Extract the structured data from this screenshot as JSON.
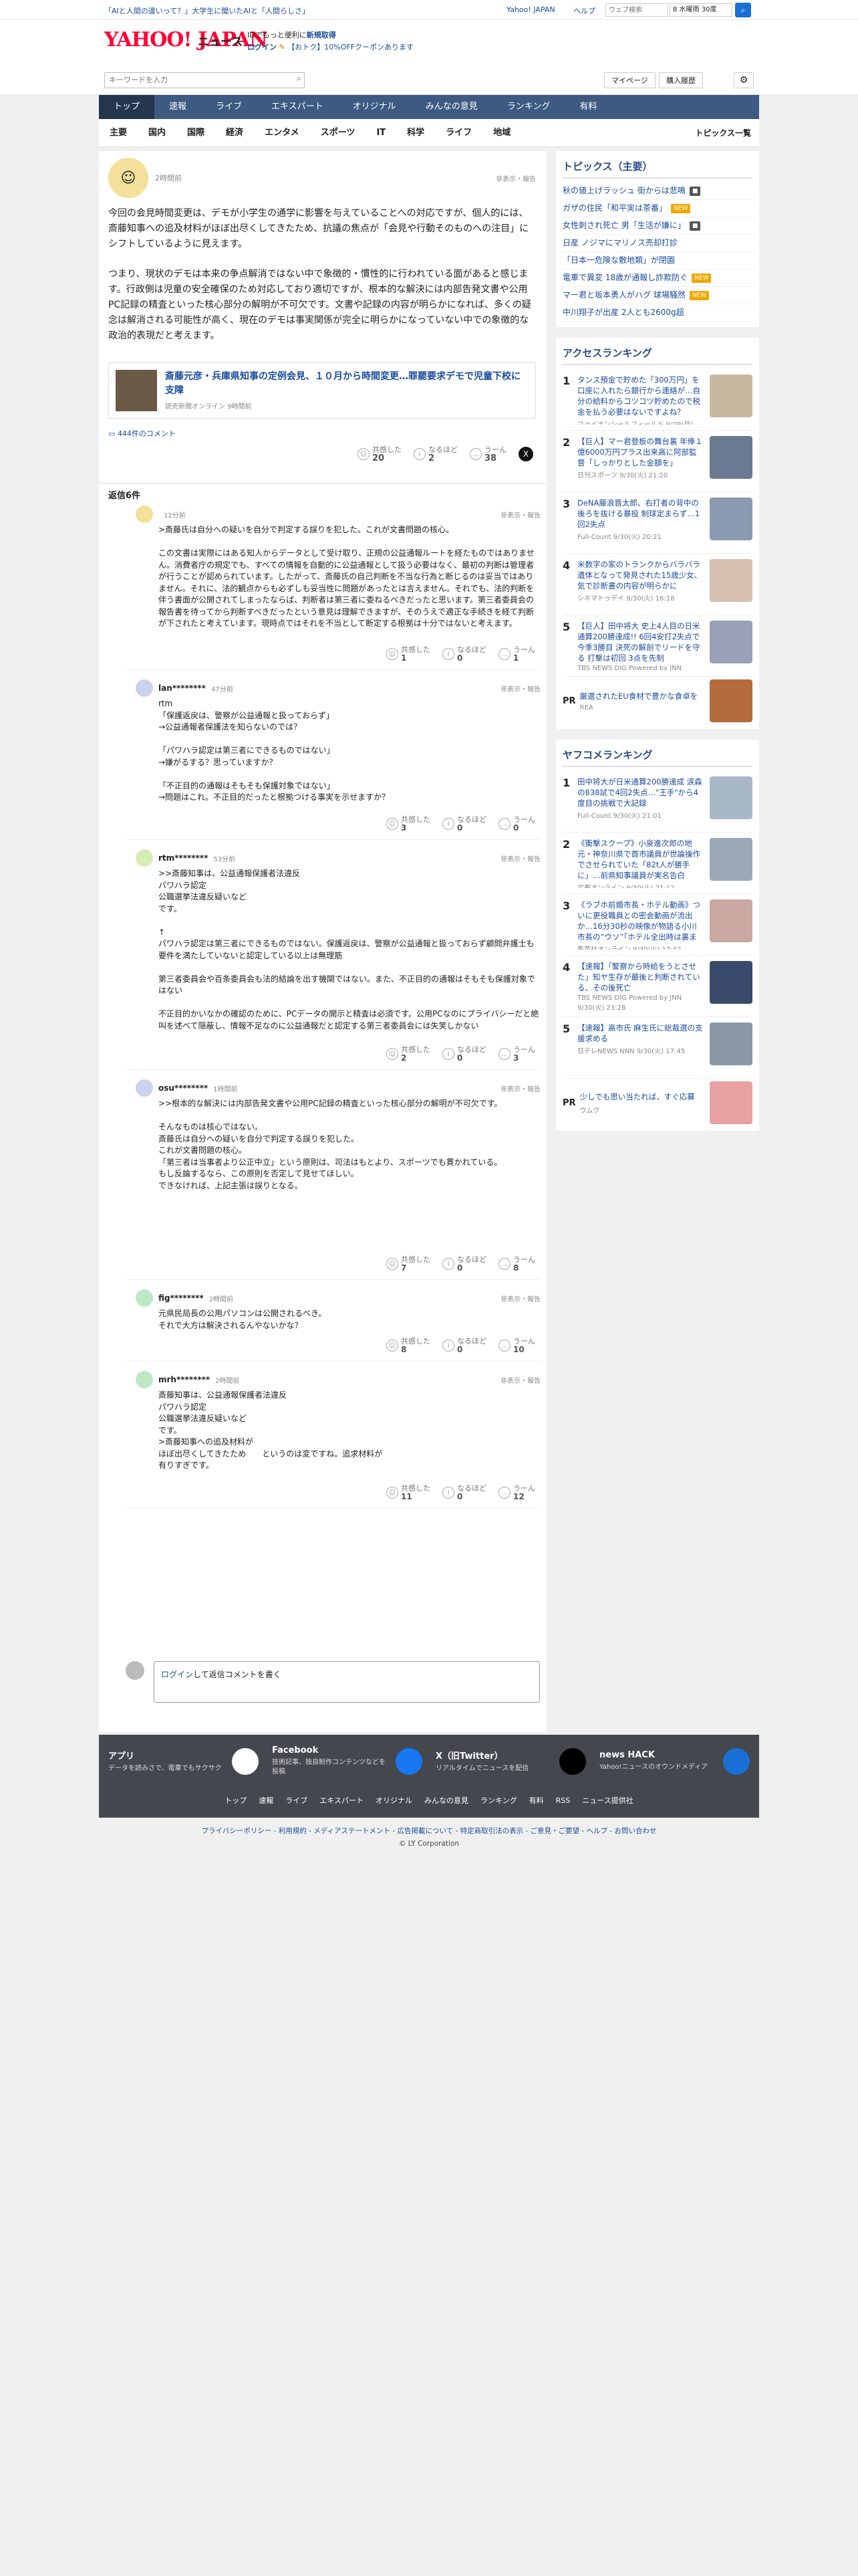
{
  "topbar": {
    "promo": "「AIと人間の違いって？」大学生に聞いたAIと「人間らしさ」",
    "links": [
      "Yahoo! JAPAN",
      "ヘルプ"
    ],
    "search_placeholder": "ウェブ検索",
    "weather": "8 水曜雨 30度"
  },
  "header": {
    "logo": "YAHOO! JAPAN",
    "logo_sub": "ニュース",
    "promo1": "IDでもっと便利に",
    "promo1b": "新規取得",
    "login": "ログイン",
    "promo2": "【おトク】10%OFFクーポンあります"
  },
  "search": {
    "placeholder": "キーワードを入力",
    "mypage": "マイページ",
    "history": "購入履歴"
  },
  "nav1": [
    "トップ",
    "速報",
    "ライブ",
    "エキスパート",
    "オリジナル",
    "みんなの意見",
    "ランキング",
    "有料"
  ],
  "nav2": [
    "主要",
    "国内",
    "国際",
    "経済",
    "エンタメ",
    "スポーツ",
    "IT",
    "科学",
    "ライフ",
    "地域"
  ],
  "nav2_right": "トピックス一覧",
  "post": {
    "time": "2時間前",
    "flag": "非表示・報告",
    "p1": "今回の会見時間変更は、デモが小学生の通学に影響を与えていることへの対応ですが、個人的には、斎藤知事への追及材料がほぼ出尽くしてきたため、抗議の焦点が「会見や行動そのものへの注目」にシフトしているように見えます。",
    "p2": "つまり、現状のデモは本来の争点解消ではない中で象徴的・慣性的に行われている面があると感じます。行政側は児童の安全確保のため対応しており適切ですが、根本的な解決には内部告発文書や公用PC記録の精査といった核心部分の解明が不可欠です。文書や記録の内容が明らかになれば、多くの疑念は解消される可能性が高く、現在のデモは事実関係が完全に明らかになっていない中での象徴的な政治的表現だと考えます。",
    "article": {
      "title": "斎藤元彦・兵庫県知事の定例会見、１０月から時間変更…罪罷要求デモで児童下校に支障",
      "source": "読売新聞オンライン",
      "age": "9時間前"
    },
    "comments_link": "444件のコメント",
    "reactions": [
      {
        "label": "共感した",
        "count": "20"
      },
      {
        "label": "なるほど",
        "count": "2"
      },
      {
        "label": "うーん",
        "count": "38"
      }
    ]
  },
  "replies_title": "返信6件",
  "replies": [
    {
      "user": "",
      "time": "12分前",
      "flag": "非表示・報告",
      "text": ">斎藤氏は自分への疑いを自分で判定する誤りを犯した。これが文書問題の核心。\n\nこの文書は実際にはある知人からデータとして受け取り、正規の公益通報ルートを経たものではありません。消費者庁の規定でも、すべての情報を自動的に公益通報として扱う必要はなく、最初の判断は管理者が行うことが認められています。したがって、斎藤氏の自己判断を不当な行為と断じるのは妥当ではありません。それに、法的観点からも必ずしも妥当性に問題があったとは言えません。それでも、法的判断を伴う書面が公開されてしまったならば、判断者は第三者に委ねるべきだったと思います。第三者委員会の報告書を待ってから判断すべきだったという意見は理解できますが、そのうえで適正な手続きを経て判断が下されたと考えています。現時点ではそれを不当として断定する根拠は十分ではないと考えます。",
      "reactions": [
        "1",
        "0",
        "1"
      ]
    },
    {
      "user": "lan********",
      "time": "47分前",
      "flag": "非表示・報告",
      "text": "rtm\n「保護返戻は、警察が公益通報と扱っておらず」\n→公益通報者保護法を知らないのでは？\n\n「パワハラ認定は第三者にできるものではない」\n→嫌がるする？思っていますか？\n\n「不正目的の通報はそもそも保護対象ではない」\n→問題はこれ。不正目的だったと根拠つける事実を示せますか？",
      "reactions": [
        "3",
        "0",
        "0"
      ]
    },
    {
      "user": "rtm********",
      "time": "53分前",
      "flag": "非表示・報告",
      "text": ">>斎藤知事は、公益通報保護者法違反\nパワハラ認定\n公職選挙法違反疑いなど\nです。\n\n↑\nパワハラ認定は第三者にできるものではない。保護返戻は、警察が公益通報と扱っておらず顧問弁護士も要件を満たしていないと認定している以上は無理筋\n\n第三者委員会や百条委員会も法的結論を出す機関ではない。また、不正目的の通報はそもそも保護対象ではない\n\n不正目的かいなかの確認のために、PCデータの開示と精査は必須です。公用PCなのにプライバシーだと絶叫を述べて隠蔽し、情報不足なのに公益通報だと認定する第三者委員会には失笑しかない",
      "reactions": [
        "2",
        "0",
        "3"
      ]
    },
    {
      "user": "osu********",
      "time": "1時間前",
      "flag": "非表示・報告",
      "text": ">>根本的な解決には内部告発文書や公用PC記録の精査といった核心部分の解明が不可欠です。\n\nそんなものは核心ではない。\n斎藤氏は自分への疑いを自分で判定する誤りを犯した。\nこれが文書問題の核心。\n「第三者は当事者より公正中立」という原則は、司法はもとより、スポーツでも貫かれている。\nもし反論するなら、この原則を否定して見せてほしい。\nできなければ、上記主張は誤りとなる。",
      "reactions": [
        "7",
        "0",
        "8"
      ]
    },
    {
      "user": "fig********",
      "time": "2時間前",
      "flag": "非表示・報告",
      "text": "元県民局長の公用パソコンは公開されるべき。\nそれで大方は解決されるんやないかな？",
      "reactions": [
        "8",
        "0",
        "10"
      ]
    },
    {
      "user": "mrh********",
      "time": "2時間前",
      "flag": "非表示・報告",
      "text": "斎藤知事は、公益通報保護者法違反\nパワハラ認定\n公職選挙法違反疑いなど\nです。\n>斎藤知事への追及材料が\nほぼ出尽くしてきたため　　というのは変ですね。追求材料が\n有りすぎです。",
      "reactions": [
        "11",
        "0",
        "12"
      ]
    }
  ],
  "reply_box": {
    "login": "ログイン",
    "rest": "して返信コメントを書く"
  },
  "side": {
    "topics_title": "トピックス（主要）",
    "topics": [
      {
        "t": "秋の値上げラッシュ 街からは悲鳴",
        "b": "■"
      },
      {
        "t": "ガザの住民「和平実は茶番」",
        "b": "NEW"
      },
      {
        "t": "女性刺され死亡 男「生活が嫌に」",
        "b": "■"
      },
      {
        "t": "日産 ノジマにマリノス売却打診",
        "b": ""
      },
      {
        "t": "「日本一危険な敷地類」が閉園",
        "b": ""
      },
      {
        "t": "電車で異変 18歳が通報し詐欺防ぐ",
        "b": "NEW"
      },
      {
        "t": "マー君と坂本勇人がハグ 球場騒然",
        "b": "NEW"
      },
      {
        "t": "中川翔子が出産 2人とも2600g超",
        "b": ""
      }
    ],
    "access_title": "アクセスランキング",
    "access": [
      {
        "t": "タンス預金で貯めた「300万円」を口座に入れたら銀行から連絡が…自分の給料からコツコツ貯めたので税金を払う必要はないですよね？",
        "s": "ファイナンシャルフィールド 9/29(月) 18:10"
      },
      {
        "t": "【巨人】マー君登板の舞台裏 年俸１億6000万円プラス出来高に阿部監督「しっかりとした金額を」",
        "s": "日刊スポーツ 9/30(火) 21:20"
      },
      {
        "t": "DeNA藤浪晋太郎、右打者の背中の後ろを抜ける暴投 制球定まらず…1回2失点",
        "s": "Full-Count 9/30(火) 20:21"
      },
      {
        "t": "米数字の家のトランクからバラバラ遺体となって発見された15歳少女、気で診断書の内容が明らかに",
        "s": "シネマトゥデイ 9/30(火) 16:18"
      },
      {
        "t": "【巨人】田中将大 史上4人目の日米通算200勝達成!! 6回4安打2失点で今季3勝目 決死の解剖でリードを守る 打撃は初回 3点を先制",
        "s": "TBS NEWS DIG Powered by JNN 9/30(火) 21:01"
      }
    ],
    "pr1": {
      "t": "厳選されたEU食材で豊かな食卓を",
      "s": "REA"
    },
    "yahoo_title": "ヤフコメランキング",
    "yahoo": [
      {
        "t": "田中将大が日米通算200勝達成 涙森の838試で4回2失点…\"王手\"から4度目の挑戦で大記録",
        "s": "Full-Count 9/30(火) 21:01"
      },
      {
        "t": "《衝撃スクープ》小泉進次郎の地元・神奈川県で首市議員が世論操作でさせられていた「82t人が勝手に」…前県知事議員が実名告白",
        "s": "文春オンライン 9/30(火) 21:12"
      },
      {
        "t": "《ラブホ前婚市長・ホテル動画》ついに更役職員との密会動画が流出か…16分30秒の映像が物語る小川市長の“ウソ”「ホテル全出時は裏まで」",
        "s": "集英社オンライン 9/30(火) 17:42"
      },
      {
        "t": "【速報】「警察から時給をうとさせた」知ヤ生存が最後と判断されている、その後死亡",
        "s": "TBS NEWS DIG Powered by JNN 9/30(火) 23:28"
      },
      {
        "t": "【速報】高市氏 麻生氏に総裁選の支援求める",
        "s": "日テレNEWS NNN 9/30(火) 17:45"
      }
    ],
    "pr2": {
      "t": "少しでも思い当たれば、すぐ応募",
      "s": "ウムク"
    }
  },
  "footer": {
    "items": [
      {
        "title": "アプリ",
        "desc": "データを読みさで、電車でもサクサク"
      },
      {
        "title": "Facebook",
        "desc": "技術記事、独自制作コンテンツなどを投稿"
      },
      {
        "title": "X（旧Twitter）",
        "desc": "リアルタイムでニュースを配信"
      },
      {
        "title": "news HACK",
        "desc": "Yahoo!ニュースのオウンドメディア"
      }
    ],
    "links": [
      "トップ",
      "速報",
      "ライブ",
      "エキスパート",
      "オリジナル",
      "みんなの意見",
      "ランキング",
      "有料",
      "RSS",
      "ニュース提供社"
    ],
    "legal": "プライバシーポリシー - 利用規約 - メディアステートメント - 広告掲載について - 特定商取引法の表示 - ご意見・ご要望 - ヘルプ - お問い合わせ",
    "copyright": "© LY Corporation"
  },
  "colors": {
    "nav": "#3c5a82",
    "link": "#1a4b9b",
    "new_badge": "#f0a800",
    "footer": "#44474e"
  }
}
